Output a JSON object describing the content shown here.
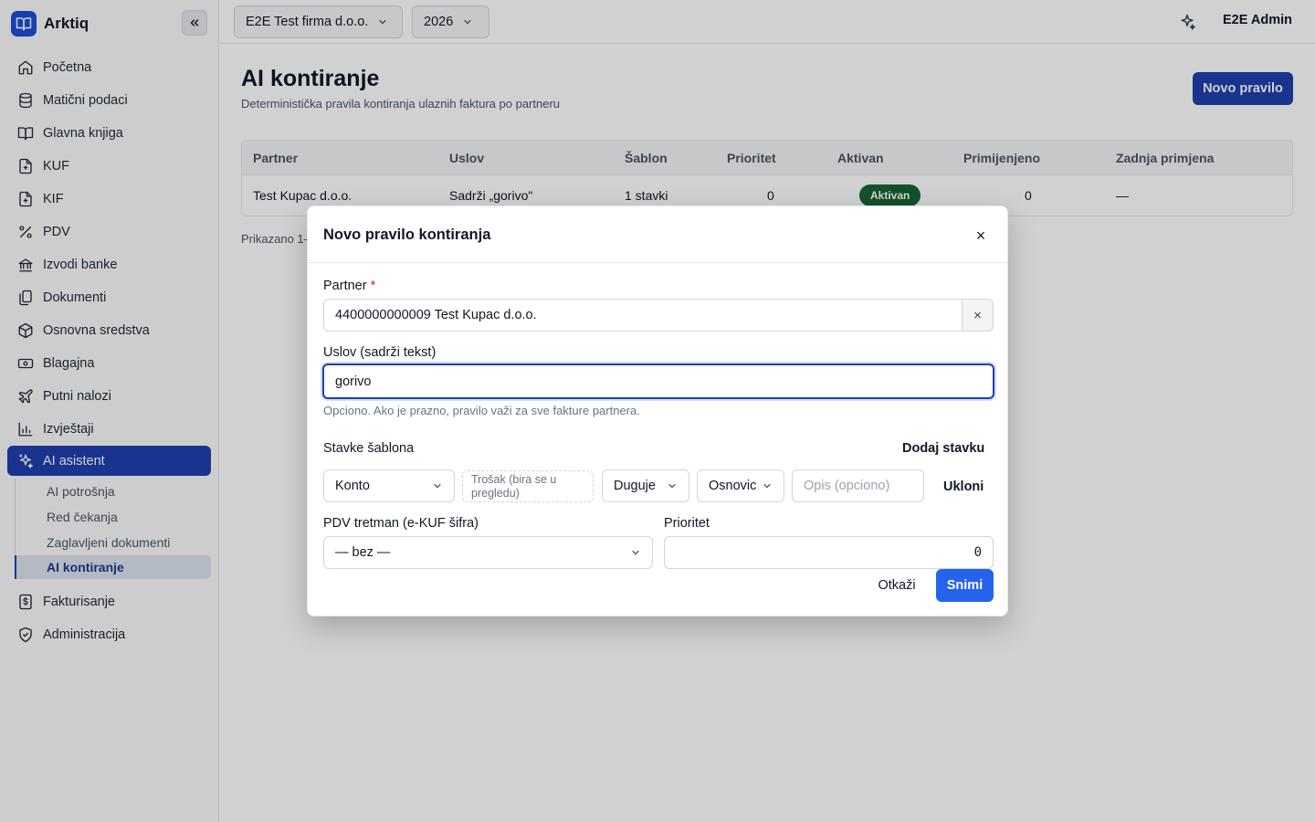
{
  "app": {
    "name": "Arktiq"
  },
  "topbar": {
    "company": "E2E Test firma d.o.o.",
    "year": "2026",
    "user": "E2E Admin"
  },
  "sidebar": {
    "items": [
      {
        "label": "Početna",
        "icon": "home-icon"
      },
      {
        "label": "Matični podaci",
        "icon": "database-icon"
      },
      {
        "label": "Glavna knjiga",
        "icon": "book-icon"
      },
      {
        "label": "KUF",
        "icon": "file-import-icon"
      },
      {
        "label": "KIF",
        "icon": "file-export-icon"
      },
      {
        "label": "PDV",
        "icon": "percent-icon"
      },
      {
        "label": "Izvodi banke",
        "icon": "bank-icon"
      },
      {
        "label": "Dokumenti",
        "icon": "documents-icon"
      },
      {
        "label": "Osnovna sredstva",
        "icon": "package-icon"
      },
      {
        "label": "Blagajna",
        "icon": "cash-icon"
      },
      {
        "label": "Putni nalozi",
        "icon": "plane-icon"
      },
      {
        "label": "Izvještaji",
        "icon": "chart-icon"
      },
      {
        "label": "AI asistent",
        "icon": "sparkles-icon"
      },
      {
        "label": "Fakturisanje",
        "icon": "invoice-icon"
      },
      {
        "label": "Administracija",
        "icon": "shield-icon"
      }
    ],
    "subitems": [
      "AI potrošnja",
      "Red čekanja",
      "Zaglavljeni dokumenti",
      "AI kontiranje"
    ]
  },
  "page": {
    "title": "AI kontiranje",
    "subtitle": "Deterministička pravila kontiranja ulaznih faktura po partneru",
    "new_button": "Novo pravilo",
    "pager": "Prikazano 1–"
  },
  "table": {
    "headers": [
      "Partner",
      "Uslov",
      "Šablon",
      "Prioritet",
      "Aktivan",
      "Primijenjeno",
      "Zadnja primjena"
    ],
    "row": {
      "partner": "Test Kupac d.o.o.",
      "condition": "Sadrži „gorivo\"",
      "template": "1 stavki",
      "priority": "0",
      "active": "Aktivan",
      "applied": "0",
      "last_applied": "—"
    }
  },
  "modal": {
    "title": "Novo pravilo kontiranja",
    "close": "×",
    "partner_label": "Partner",
    "required_mark": "*",
    "partner_value": "4400000000009 Test Kupac d.o.o.",
    "clear": "×",
    "condition_label": "Uslov (sadrži tekst)",
    "condition_value": "gorivo",
    "condition_hint": "Opciono. Ako je prazno, pravilo važi za sve fakture partnera.",
    "lines_label": "Stavke šablona",
    "add_line": "Dodaj stavku",
    "line": {
      "account": "Konto",
      "cost_hint": "Trošak (bira se u pregledu)",
      "side": "Duguje",
      "base": "Osnovic",
      "description_placeholder": "Opis (opciono)",
      "remove": "Ukloni"
    },
    "vat_label": "PDV tretman (e-KUF šifra)",
    "vat_value": "— bez —",
    "priority_label": "Prioritet",
    "priority_value": "0",
    "cancel": "Otkaži",
    "save": "Snimi"
  },
  "colors": {
    "primary": "#1e40af",
    "save": "#2563eb",
    "success": "#166534",
    "danger": "#dc2626"
  }
}
